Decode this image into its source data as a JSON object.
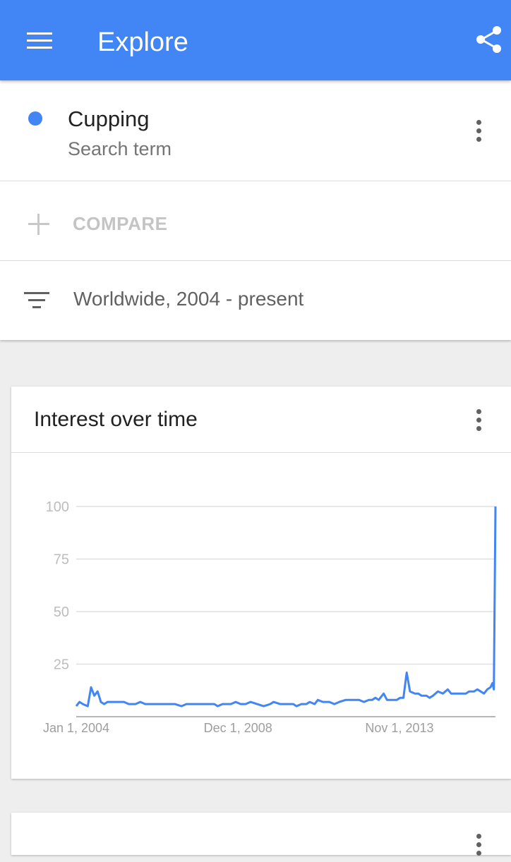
{
  "header": {
    "title": "Explore",
    "menu_icon": "menu-icon",
    "share_icon": "share-icon",
    "color": "#4285f4"
  },
  "search_term": {
    "name": "Cupping",
    "type": "Search term",
    "color": "#4285f4"
  },
  "compare": {
    "label": "COMPARE"
  },
  "filter": {
    "label": "Worldwide, 2004 - present",
    "icon": "filter-icon"
  },
  "card": {
    "title": "Interest over time"
  },
  "chart_data": {
    "type": "line",
    "title": "Interest over time",
    "xlabel": "",
    "ylabel": "",
    "ylim": [
      0,
      100
    ],
    "yticks": [
      25,
      50,
      75,
      100
    ],
    "xticks": [
      {
        "label": "Jan 1, 2004",
        "t": 2004.0
      },
      {
        "label": "Dec 1, 2008",
        "t": 2008.92
      },
      {
        "label": "Nov 1, 2013",
        "t": 2013.83
      }
    ],
    "xlim": [
      2004.0,
      2016.75
    ],
    "series": [
      {
        "name": "Cupping",
        "color": "#4285f4",
        "points": [
          [
            2004.0,
            5
          ],
          [
            2004.1,
            7
          ],
          [
            2004.2,
            6
          ],
          [
            2004.35,
            5
          ],
          [
            2004.45,
            14
          ],
          [
            2004.55,
            10
          ],
          [
            2004.65,
            12
          ],
          [
            2004.75,
            7
          ],
          [
            2004.85,
            6
          ],
          [
            2004.95,
            7
          ],
          [
            2005.2,
            7
          ],
          [
            2005.45,
            7
          ],
          [
            2005.6,
            6
          ],
          [
            2005.8,
            6
          ],
          [
            2005.95,
            7
          ],
          [
            2006.1,
            6
          ],
          [
            2006.4,
            6
          ],
          [
            2006.7,
            6
          ],
          [
            2007.0,
            6
          ],
          [
            2007.2,
            5
          ],
          [
            2007.35,
            6
          ],
          [
            2007.6,
            6
          ],
          [
            2007.9,
            6
          ],
          [
            2008.2,
            6
          ],
          [
            2008.3,
            5
          ],
          [
            2008.45,
            6
          ],
          [
            2008.7,
            6
          ],
          [
            2008.85,
            7
          ],
          [
            2009.0,
            6
          ],
          [
            2009.15,
            6
          ],
          [
            2009.3,
            7
          ],
          [
            2009.5,
            6
          ],
          [
            2009.7,
            5
          ],
          [
            2009.9,
            6
          ],
          [
            2010.0,
            7
          ],
          [
            2010.2,
            6
          ],
          [
            2010.4,
            6
          ],
          [
            2010.6,
            6
          ],
          [
            2010.7,
            5
          ],
          [
            2010.85,
            6
          ],
          [
            2011.0,
            6
          ],
          [
            2011.1,
            7
          ],
          [
            2011.25,
            6
          ],
          [
            2011.35,
            8
          ],
          [
            2011.5,
            7
          ],
          [
            2011.7,
            7
          ],
          [
            2011.85,
            6
          ],
          [
            2012.0,
            7
          ],
          [
            2012.2,
            8
          ],
          [
            2012.4,
            8
          ],
          [
            2012.6,
            8
          ],
          [
            2012.75,
            7
          ],
          [
            2012.9,
            8
          ],
          [
            2013.0,
            8
          ],
          [
            2013.1,
            9
          ],
          [
            2013.2,
            8
          ],
          [
            2013.35,
            11
          ],
          [
            2013.45,
            8
          ],
          [
            2013.6,
            8
          ],
          [
            2013.75,
            8
          ],
          [
            2013.85,
            9
          ],
          [
            2013.95,
            9
          ],
          [
            2014.05,
            21
          ],
          [
            2014.15,
            12
          ],
          [
            2014.3,
            11
          ],
          [
            2014.4,
            11
          ],
          [
            2014.5,
            10
          ],
          [
            2014.65,
            10
          ],
          [
            2014.75,
            9
          ],
          [
            2014.85,
            10
          ],
          [
            2015.0,
            12
          ],
          [
            2015.15,
            11
          ],
          [
            2015.3,
            13
          ],
          [
            2015.4,
            11
          ],
          [
            2015.55,
            11
          ],
          [
            2015.7,
            11
          ],
          [
            2015.85,
            11
          ],
          [
            2015.95,
            12
          ],
          [
            2016.1,
            12
          ],
          [
            2016.2,
            13
          ],
          [
            2016.3,
            12
          ],
          [
            2016.4,
            11
          ],
          [
            2016.5,
            13
          ],
          [
            2016.6,
            14
          ],
          [
            2016.66,
            16
          ],
          [
            2016.7,
            13
          ],
          [
            2016.75,
            100
          ]
        ]
      }
    ]
  }
}
